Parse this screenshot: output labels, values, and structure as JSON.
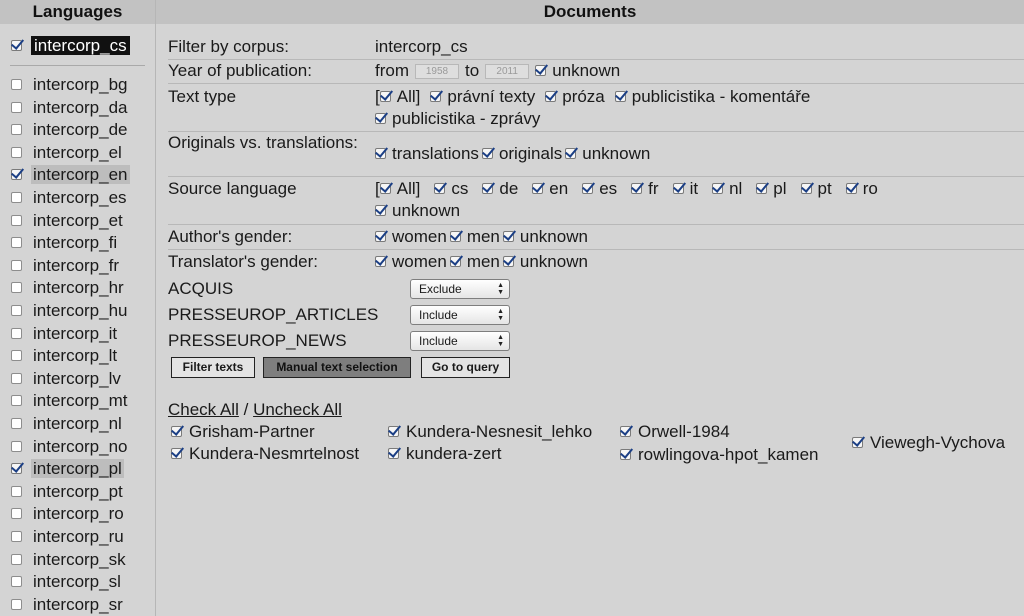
{
  "left_panel": {
    "header": "Languages",
    "primary": {
      "label": "intercorp_cs",
      "checked": true
    },
    "languages": [
      {
        "label": "intercorp_bg",
        "checked": false
      },
      {
        "label": "intercorp_da",
        "checked": false
      },
      {
        "label": "intercorp_de",
        "checked": false
      },
      {
        "label": "intercorp_el",
        "checked": false
      },
      {
        "label": "intercorp_en",
        "checked": true
      },
      {
        "label": "intercorp_es",
        "checked": false
      },
      {
        "label": "intercorp_et",
        "checked": false
      },
      {
        "label": "intercorp_fi",
        "checked": false
      },
      {
        "label": "intercorp_fr",
        "checked": false
      },
      {
        "label": "intercorp_hr",
        "checked": false
      },
      {
        "label": "intercorp_hu",
        "checked": false
      },
      {
        "label": "intercorp_it",
        "checked": false
      },
      {
        "label": "intercorp_lt",
        "checked": false
      },
      {
        "label": "intercorp_lv",
        "checked": false
      },
      {
        "label": "intercorp_mt",
        "checked": false
      },
      {
        "label": "intercorp_nl",
        "checked": false
      },
      {
        "label": "intercorp_no",
        "checked": false
      },
      {
        "label": "intercorp_pl",
        "checked": true
      },
      {
        "label": "intercorp_pt",
        "checked": false
      },
      {
        "label": "intercorp_ro",
        "checked": false
      },
      {
        "label": "intercorp_ru",
        "checked": false
      },
      {
        "label": "intercorp_sk",
        "checked": false
      },
      {
        "label": "intercorp_sl",
        "checked": false
      },
      {
        "label": "intercorp_sr",
        "checked": false
      }
    ]
  },
  "documents": {
    "header": "Documents",
    "filter_by_corpus": {
      "label": "Filter by corpus:",
      "value": "intercorp_cs"
    },
    "year": {
      "label": "Year of publication:",
      "from_label": "from",
      "from_value": "1958",
      "to_label": "to",
      "to_value": "2011",
      "unknown_label": "unknown"
    },
    "text_type": {
      "label": "Text type",
      "all_prefix": "[",
      "all_label": "All]",
      "options": [
        "právní texty",
        "próza",
        "publicistika - komentáře",
        "publicistika - zprávy"
      ]
    },
    "originals": {
      "label": "Originals vs. translations:",
      "options": [
        "translations",
        "originals",
        "unknown"
      ]
    },
    "source_language": {
      "label": "Source language",
      "all_prefix": "[",
      "all_label": "All]",
      "options": [
        "cs",
        "de",
        "en",
        "es",
        "fr",
        "it",
        "nl",
        "pl",
        "pt",
        "ro",
        "unknown"
      ]
    },
    "author_gender": {
      "label": "Author's gender:",
      "options": [
        "women",
        "men",
        "unknown"
      ]
    },
    "translator_gender": {
      "label": "Translator's gender:",
      "options": [
        "women",
        "men",
        "unknown"
      ]
    },
    "selects": [
      {
        "label": "ACQUIS",
        "value": "Exclude"
      },
      {
        "label": "PRESSEUROP_ARTICLES",
        "value": "Include"
      },
      {
        "label": "PRESSEUROP_NEWS",
        "value": "Include"
      }
    ],
    "buttons": {
      "filter": "Filter texts",
      "manual": "Manual text selection",
      "go": "Go to query"
    },
    "check_all": "Check All",
    "separator": "/",
    "uncheck_all": "Uncheck All",
    "doc_list": [
      "Grisham-Partner",
      "Kundera-Nesmrtelnost",
      "Kundera-Nesnesit_lehko",
      "kundera-zert",
      "Orwell-1984",
      "rowlingova-hpot_kamen",
      "Viewegh-Vychova"
    ]
  }
}
